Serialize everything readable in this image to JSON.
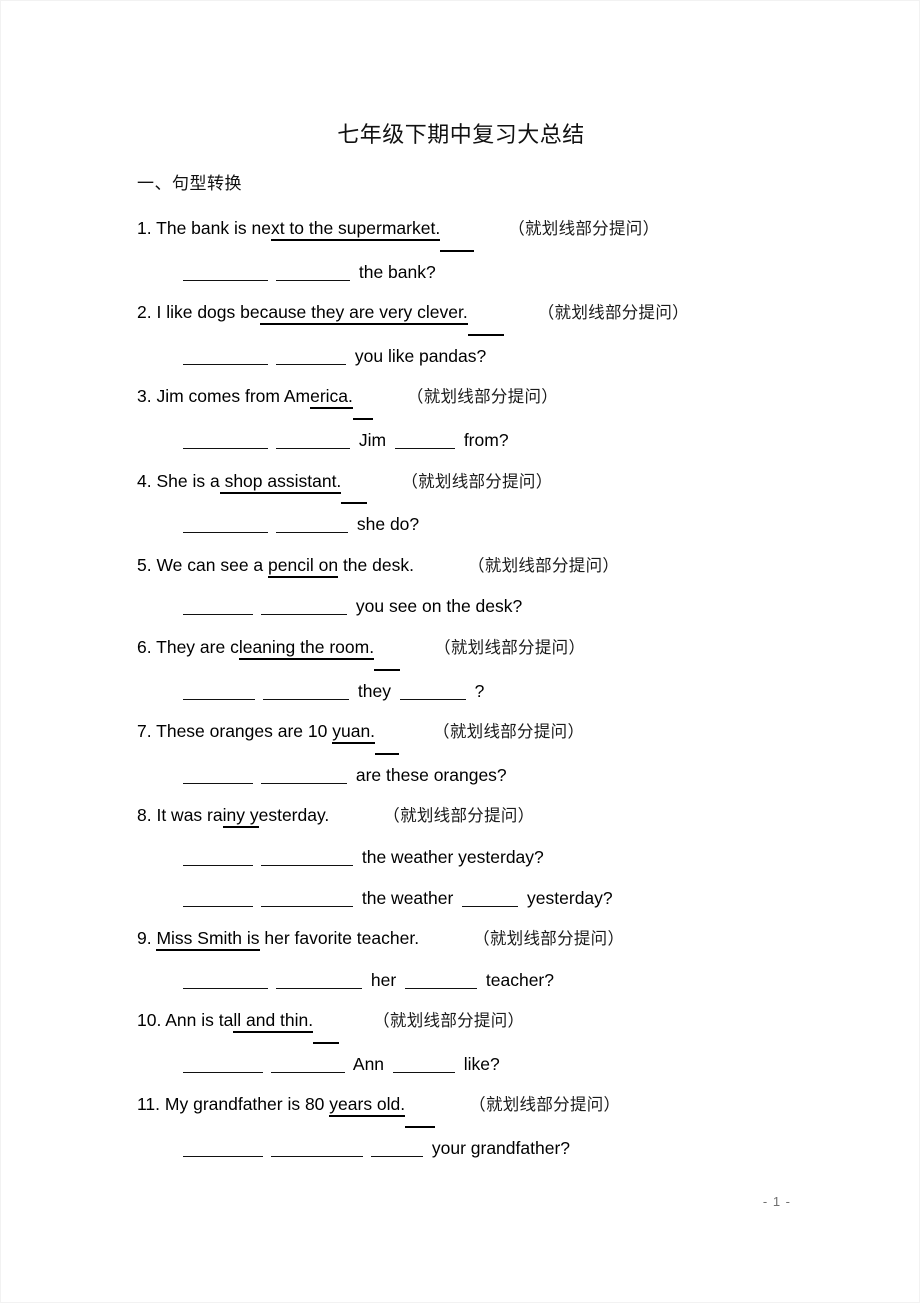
{
  "document": {
    "title": "七年级下期中复习大总结",
    "section_heading": "一、句型转换",
    "footer": "- 1 -",
    "instruction_note": "（就划线部分提问）"
  },
  "questions": [
    {
      "number": "1.",
      "prompt_before": "The bank is ne",
      "prompt_underlined": "xt to the supermarket.",
      "prompt_after": "",
      "note": "（就划线部分提问）",
      "answer_before": "",
      "answer_mid": "",
      "answer_after": "the bank?",
      "blank_widths": [
        85,
        74
      ],
      "tail_width": 34
    },
    {
      "number": "2.",
      "prompt_before": "I like dogs be",
      "prompt_underlined": "cause they are very clever.",
      "prompt_after": "",
      "note": "（就划线部分提问）",
      "answer_before": "",
      "answer_mid": "",
      "answer_after": "you like pandas?",
      "blank_widths": [
        85,
        70
      ],
      "tail_width": 36
    },
    {
      "number": "3.",
      "prompt_before": "Jim comes from Am",
      "prompt_underlined": "erica.",
      "prompt_after": "",
      "note": "（就划线部分提问）",
      "answer_before": "",
      "answer_mid": "Jim",
      "answer_after": "from?",
      "blank_widths": [
        85,
        74,
        60
      ],
      "tail_width": 20
    },
    {
      "number": "4.",
      "prompt_before": "She is a",
      "prompt_underlined": " shop assistant.",
      "prompt_after": "",
      "note": "（就划线部分提问）",
      "answer_before": "",
      "answer_mid": "",
      "answer_after": "she do?",
      "blank_widths": [
        85,
        72
      ],
      "tail_width": 26
    },
    {
      "number": "5.",
      "prompt_before": "We can see a ",
      "prompt_underlined": "pencil on",
      "prompt_after": " the desk.",
      "note": "（就划线部分提问）",
      "answer_before": "",
      "answer_mid": "",
      "answer_after": "you see on the desk?",
      "blank_widths": [
        70,
        86
      ],
      "tail_width": 0
    },
    {
      "number": "6.",
      "prompt_before": "They are c",
      "prompt_underlined": "leaning the room.",
      "prompt_after": "",
      "note": "（就划线部分提问）",
      "answer_before": "",
      "answer_mid": "they",
      "answer_after": "?",
      "blank_widths": [
        72,
        86,
        66
      ],
      "tail_width": 26
    },
    {
      "number": "7.",
      "prompt_before": "These oranges are 10 ",
      "prompt_underlined": "yuan.",
      "prompt_after": "",
      "note": "（就划线部分提问）",
      "answer_before": "",
      "answer_mid": "",
      "answer_after": "are these oranges?",
      "blank_widths": [
        70,
        86
      ],
      "tail_width": 24
    },
    {
      "number": "8.",
      "prompt_before": "It was ra",
      "prompt_underlined": "iny y",
      "prompt_after": "esterday.",
      "note": "（就划线部分提问）",
      "answer_before": "",
      "answer_mid": "",
      "answer_after": "the weather yesterday?",
      "blank_widths": [
        70,
        92
      ],
      "tail_width": 0,
      "extra_answer": {
        "blank_widths": [
          70,
          92,
          56
        ],
        "mid": "the weather",
        "after": "yesterday?"
      }
    },
    {
      "number": "9.",
      "prompt_before": "",
      "prompt_underlined": "Miss Smith is",
      "prompt_after": " her favorite teacher.",
      "note": "（就划线部分提问）",
      "answer_before": "",
      "answer_mid": "her",
      "answer_after": "teacher?",
      "blank_widths": [
        85,
        86,
        72
      ],
      "tail_width": 0
    },
    {
      "number": "10.",
      "prompt_before": "Ann is ta",
      "prompt_underlined": "ll and thin.",
      "prompt_after": "",
      "note": "（就划线部分提问）",
      "answer_before": "",
      "answer_mid": "Ann",
      "answer_after": "like?",
      "blank_widths": [
        80,
        74,
        62
      ],
      "tail_width": 26
    },
    {
      "number": "11.",
      "prompt_before": "My grandfather is 80 ",
      "prompt_underlined": "years old.",
      "prompt_after": "",
      "note": "（就划线部分提问）",
      "answer_before": "",
      "answer_mid": "",
      "answer_after": "your grandfather?",
      "blank_widths": [
        80,
        92,
        52
      ],
      "tail_width": 30
    }
  ]
}
